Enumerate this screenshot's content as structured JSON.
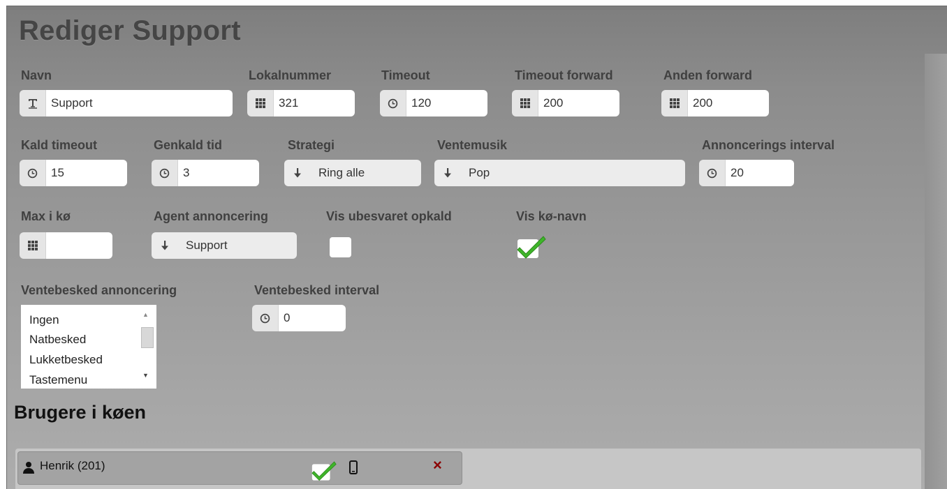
{
  "title": "Rediger Support",
  "fields": {
    "navn": {
      "label": "Navn",
      "value": "Support",
      "icon": "text-icon"
    },
    "lokalnummer": {
      "label": "Lokalnummer",
      "value": "321",
      "icon": "keypad-icon"
    },
    "timeout": {
      "label": "Timeout",
      "value": "120",
      "icon": "clock-icon"
    },
    "timeout_forward": {
      "label": "Timeout forward",
      "value": "200",
      "icon": "keypad-icon"
    },
    "anden_forward": {
      "label": "Anden forward",
      "value": "200",
      "icon": "keypad-icon"
    },
    "kald_timeout": {
      "label": "Kald timeout",
      "value": "15",
      "icon": "clock-icon"
    },
    "genkald_tid": {
      "label": "Genkald tid",
      "value": "3",
      "icon": "clock-icon"
    },
    "strategi": {
      "label": "Strategi",
      "value": "Ring alle",
      "icon": "arrow-down-icon"
    },
    "ventemusik": {
      "label": "Ventemusik",
      "value": "Pop",
      "icon": "arrow-down-icon"
    },
    "annoncerings_interval": {
      "label": "Annoncerings interval",
      "value": "20",
      "icon": "clock-icon"
    },
    "max_i_koe": {
      "label": "Max i kø",
      "value": "",
      "icon": "keypad-icon"
    },
    "agent_annoncering": {
      "label": "Agent annoncering",
      "value": "Support",
      "icon": "arrow-down-icon"
    },
    "vis_ubesvaret_opkald": {
      "label": "Vis ubesvaret opkald",
      "checked": false
    },
    "vis_koe_navn": {
      "label": "Vis kø-navn",
      "checked": true
    },
    "ventebesked_annoncering": {
      "label": "Ventebesked annoncering",
      "options": [
        "Ingen",
        "Natbesked",
        "Lukketbesked",
        "Tastemenu"
      ]
    },
    "ventebesked_interval": {
      "label": "Ventebesked interval",
      "value": "0",
      "icon": "clock-icon"
    }
  },
  "queue_users": {
    "title": "Brugere i køen",
    "users": [
      {
        "name": "Henrik (201)",
        "active": true,
        "device_icon": "mobile-phone-icon",
        "remove_icon": "close-icon"
      }
    ]
  },
  "colors": {
    "check": "#3fb52a",
    "remove": "#8b0000"
  }
}
